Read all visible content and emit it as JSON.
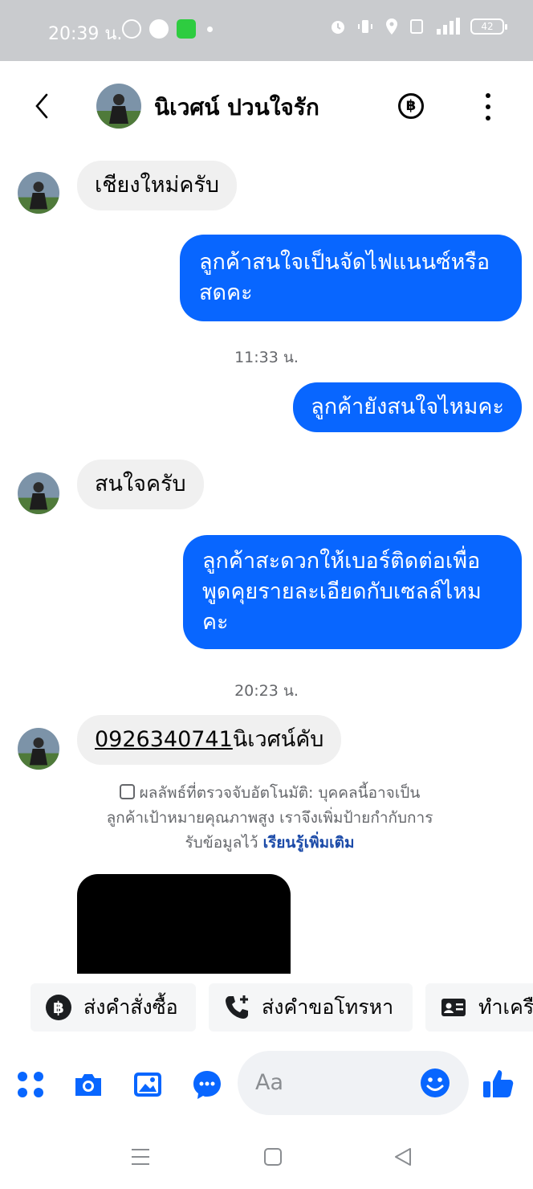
{
  "status_bar": {
    "time": "20:39 น.",
    "battery": "42"
  },
  "header": {
    "contact_name": "นิเวศน์ ปวนใจรัก",
    "baht_symbol": "฿"
  },
  "messages": [
    {
      "side": "in",
      "text": "เชียงใหม่ครับ"
    },
    {
      "side": "out",
      "line1": "ลูกค้าสนใจเป็นจัดไฟแนนซ์หรือ",
      "line2": "สดคะ"
    },
    {
      "side": "out",
      "text": "ลูกค้ายังสนใจไหมคะ"
    },
    {
      "side": "in",
      "text": "สนใจครับ"
    },
    {
      "side": "out",
      "line1": "ลูกค้าสะดวกให้เบอร์ติดต่อเพื่อ",
      "line2": "พูดคุยรายละเอียดกับเซลล์ไหม",
      "line3": "คะ"
    },
    {
      "side": "in",
      "phone": "0926340741",
      "suffix": "นิเวศน์คับ"
    }
  ],
  "timestamps": {
    "first": "11:33 น.",
    "second": "20:23 น."
  },
  "notice": {
    "line1": "ผลลัพธ์ที่ตรวจจับอัตโนมัติ: บุคคลนี้อาจเป็น",
    "line2": "ลูกค้าเป้าหมายคุณภาพสูง เราจึงเพิ่มป้ายกำกับการ",
    "line3": "รับข้อมูลไว้",
    "link": "เรียนรู้เพิ่มเติม"
  },
  "quick_replies": [
    {
      "label": "ส่งคำสั่งซื้อ",
      "icon": "baht-circle-icon"
    },
    {
      "label": "ส่งคำขอโทรหา",
      "icon": "phone-plus-icon"
    },
    {
      "label": "ทำเครื",
      "icon": "id-card-icon"
    }
  ],
  "composer": {
    "placeholder": "Aa"
  },
  "colors": {
    "accent": "#0866ff",
    "incoming_bubble": "#f0f0f0",
    "status_bar": "#c9cbce"
  }
}
